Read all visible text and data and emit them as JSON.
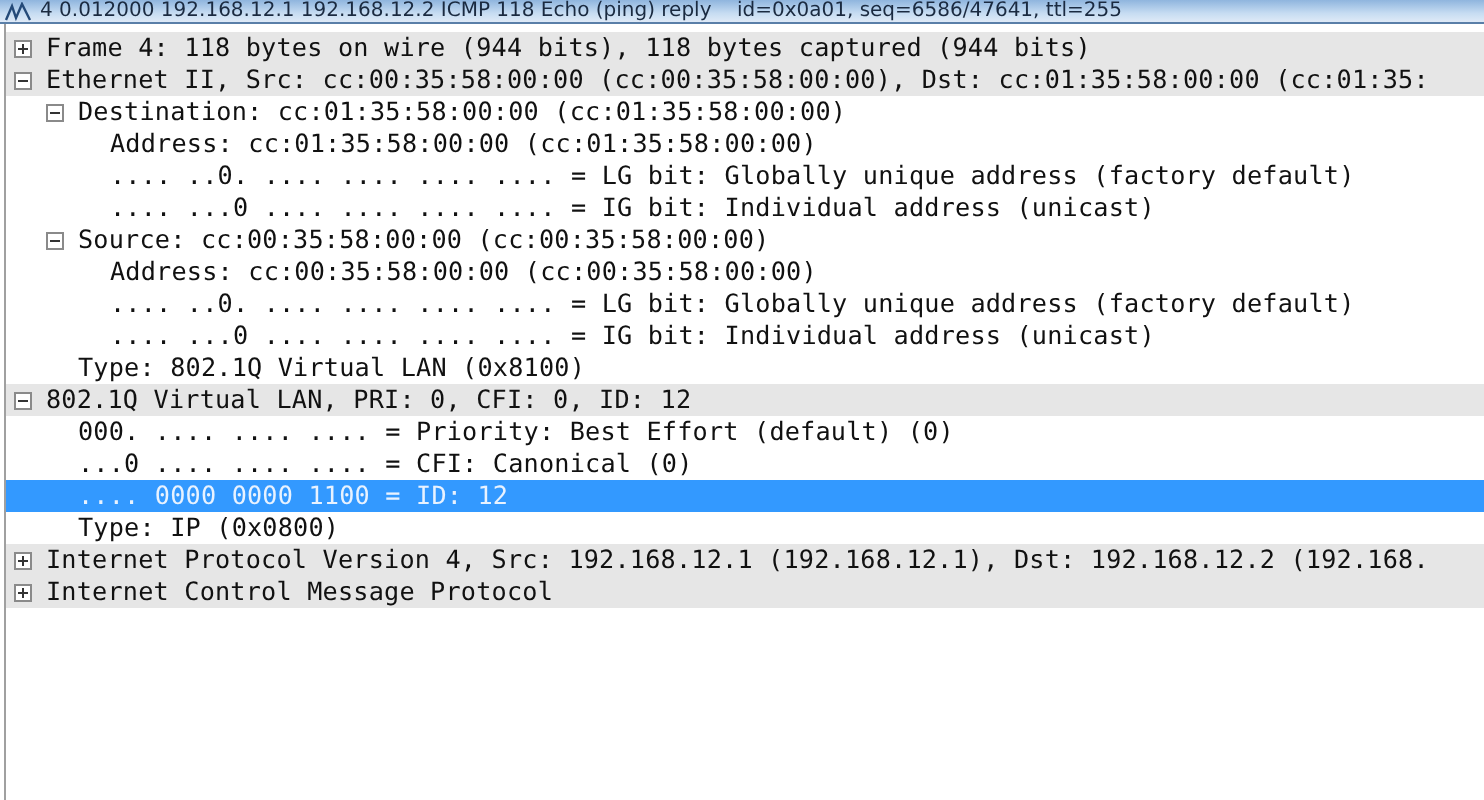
{
  "packet_list_row": {
    "text": "4 0.012000 192.168.12.1 192.168.12.2 ICMP 118 Echo (ping) reply    id=0x0a01, seq=6586/47641, ttl=255"
  },
  "details_tree": [
    {
      "kind": "branch",
      "text": "Frame 4: 118 bytes on wire (944 bits), 118 bytes captured (944 bits)",
      "expanded": false,
      "selected": false
    },
    {
      "kind": "branch",
      "text": "Ethernet II, Src: cc:00:35:58:00:00 (cc:00:35:58:00:00), Dst: cc:01:35:58:00:00 (cc:01:35:",
      "expanded": true,
      "selected": false,
      "children": [
        {
          "kind": "branch",
          "text": "Destination: cc:01:35:58:00:00 (cc:01:35:58:00:00)",
          "expanded": true,
          "selected": false,
          "children": [
            {
              "kind": "leaf",
              "text": "Address: cc:01:35:58:00:00 (cc:01:35:58:00:00)",
              "selected": false
            },
            {
              "kind": "leaf",
              "text": ".... ..0. .... .... .... .... = LG bit: Globally unique address (factory default)",
              "selected": false
            },
            {
              "kind": "leaf",
              "text": ".... ...0 .... .... .... .... = IG bit: Individual address (unicast)",
              "selected": false
            }
          ]
        },
        {
          "kind": "branch",
          "text": "Source: cc:00:35:58:00:00 (cc:00:35:58:00:00)",
          "expanded": true,
          "selected": false,
          "children": [
            {
              "kind": "leaf",
              "text": "Address: cc:00:35:58:00:00 (cc:00:35:58:00:00)",
              "selected": false
            },
            {
              "kind": "leaf",
              "text": ".... ..0. .... .... .... .... = LG bit: Globally unique address (factory default)",
              "selected": false
            },
            {
              "kind": "leaf",
              "text": ".... ...0 .... .... .... .... = IG bit: Individual address (unicast)",
              "selected": false
            }
          ]
        },
        {
          "kind": "leaf",
          "text": "Type: 802.1Q Virtual LAN (0x8100)",
          "selected": false
        }
      ]
    },
    {
      "kind": "branch",
      "text": "802.1Q Virtual LAN, PRI: 0, CFI: 0, ID: 12",
      "expanded": true,
      "selected": false,
      "children": [
        {
          "kind": "leaf",
          "text": "000. .... .... .... = Priority: Best Effort (default) (0)",
          "selected": false
        },
        {
          "kind": "leaf",
          "text": "...0 .... .... .... = CFI: Canonical (0)",
          "selected": false
        },
        {
          "kind": "leaf",
          "text": ".... 0000 0000 1100 = ID: 12",
          "selected": true
        },
        {
          "kind": "leaf",
          "text": "Type: IP (0x0800)",
          "selected": false
        }
      ]
    },
    {
      "kind": "branch",
      "text": "Internet Protocol Version 4, Src: 192.168.12.1 (192.168.12.1), Dst: 192.168.12.2 (192.168.",
      "expanded": false,
      "selected": false
    },
    {
      "kind": "branch",
      "text": "Internet Control Message Protocol",
      "expanded": false,
      "selected": false
    }
  ]
}
